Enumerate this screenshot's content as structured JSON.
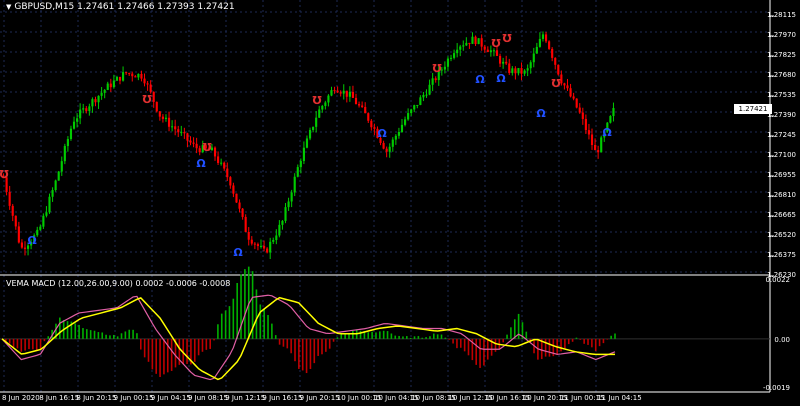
{
  "chart_title": "GBPUSD,M15  1.27461 1.27466 1.27393 1.27421",
  "indicator_title": "VEMA MACD (12.00,26.00,9.00) 0.0002 -0.0006 -0.0008",
  "price_axis": [
    "1.28115",
    "1.27970",
    "1.27825",
    "1.27680",
    "1.27535",
    "1.27390",
    "1.27245",
    "1.27100",
    "1.26955",
    "1.26810",
    "1.26665",
    "1.26520",
    "1.26375",
    "1.26230"
  ],
  "current_price": "1.27421",
  "indicator_axis": [
    "0.0022",
    "0.00",
    "-0.0019"
  ],
  "time_axis": [
    "8 Jun 2020",
    "8 Jun 16:15",
    "8 Jun 20:15",
    "9 Jun 00:15",
    "9 Jun 04:15",
    "9 Jun 08:15",
    "9 Jun 12:15",
    "9 Jun 16:15",
    "9 Jun 20:15",
    "10 Jun 00:15",
    "10 Jun 04:15",
    "10 Jun 08:15",
    "10 Jun 12:15",
    "10 Jun 16:15",
    "10 Jun 20:15",
    "11 Jun 00:15",
    "11 Jun 04:15"
  ],
  "colors": {
    "bull": "#00cc00",
    "bear": "#ff0000",
    "grid": "#1e2a55",
    "sep": "#ffffff",
    "macd": "#e05fa5",
    "signal": "#ffff00",
    "hist_pos": "#00b000",
    "hist_neg": "#c00000",
    "up_signal": "#e03030",
    "down_signal": "#2050ff"
  },
  "chart_data": {
    "type": "candlestick",
    "symbol": "GBPUSD",
    "timeframe": "M15",
    "ylim": [
      1.2623,
      1.2815
    ],
    "anchor_prices": [
      1.2693,
      1.264,
      1.2652,
      1.269,
      1.2735,
      1.2748,
      1.276,
      1.277,
      1.2768,
      1.2738,
      1.2727,
      1.2715,
      1.2712,
      1.269,
      1.265,
      1.2637,
      1.266,
      1.2705,
      1.274,
      1.276,
      1.2752,
      1.2735,
      1.2712,
      1.2735,
      1.2752,
      1.277,
      1.279,
      1.2795,
      1.2786,
      1.2772,
      1.277,
      1.28,
      1.2765,
      1.2742,
      1.271,
      1.2742
    ],
    "macd_ylim": [
      -0.0019,
      0.0022
    ],
    "macd_anchors": [
      0.0,
      -0.0008,
      -0.0006,
      0.0006,
      0.001,
      0.0011,
      0.0012,
      0.0017,
      0.0004,
      -0.0006,
      -0.0014,
      -0.0016,
      -0.0005,
      0.0016,
      0.0017,
      0.0013,
      0.0004,
      0.0002,
      0.0003,
      0.0004,
      0.0006,
      0.0005,
      0.0004,
      0.0004,
      0.0002,
      -0.0004,
      -0.0004,
      0.0002,
      -0.0004,
      -0.0006,
      -0.0005,
      -0.0008,
      -0.0005
    ],
    "signal_anchors": [
      0.0,
      -0.0006,
      -0.0004,
      0.0003,
      0.0008,
      0.001,
      0.0012,
      0.0016,
      0.0008,
      -0.0004,
      -0.0012,
      -0.0016,
      -0.0008,
      0.001,
      0.0016,
      0.0014,
      0.0006,
      0.0002,
      0.0002,
      0.0004,
      0.0005,
      0.0004,
      0.0003,
      0.0004,
      0.0002,
      -0.0002,
      -0.0003,
      0.0,
      -0.0003,
      -0.0005,
      -0.0006,
      -0.0006
    ]
  }
}
